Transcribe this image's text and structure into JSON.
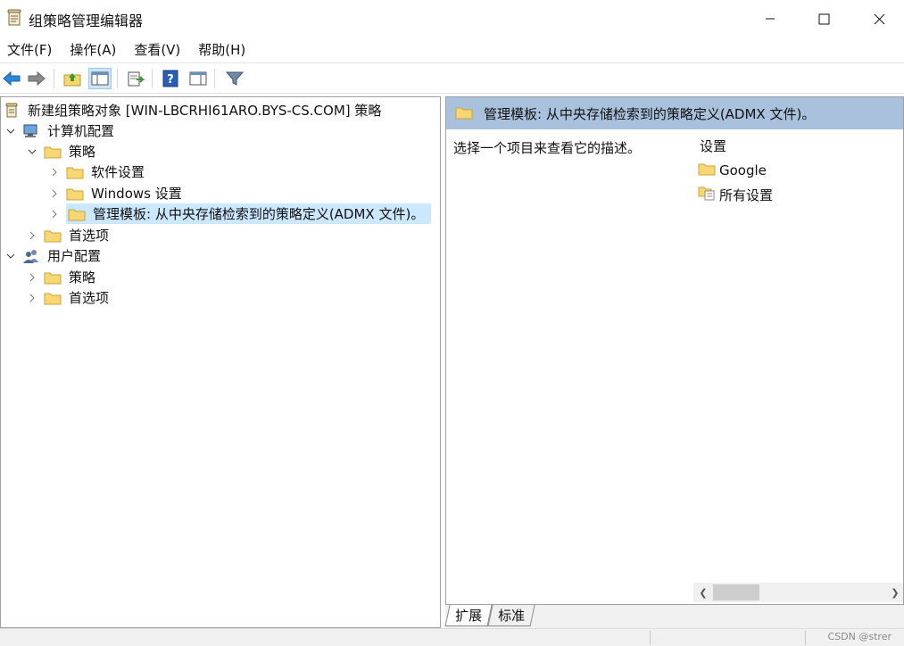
{
  "window": {
    "title": "组策略管理编辑器",
    "icon": "policy-scroll-icon"
  },
  "menu": [
    "文件(F)",
    "操作(A)",
    "查看(V)",
    "帮助(H)"
  ],
  "toolbar": {
    "icons": [
      "back-arrow-icon",
      "forward-arrow-icon",
      "up-folder-icon",
      "show-hide-tree-icon",
      "export-list-icon",
      "help-icon",
      "properties-icon",
      "filter-icon"
    ],
    "accent": "#cce4f7"
  },
  "tree": {
    "root": "新建组策略对象 [WIN-LBCRHI61ARO.BYS-CS.COM] 策略",
    "computer_config": "计算机配置",
    "computer_policy": "策略",
    "software_settings": "软件设置",
    "windows_settings": "Windows 设置",
    "admin_templates": "管理模板: 从中央存储检索到的策略定义(ADMX 文件)。",
    "computer_preferences": "首选项",
    "user_config": "用户配置",
    "user_policy": "策略",
    "user_preferences": "首选项"
  },
  "right": {
    "header": "管理模板: 从中央存储检索到的策略定义(ADMX 文件)。",
    "description": "选择一个项目来查看它的描述。",
    "column_header": "设置",
    "items": [
      "Google",
      "所有设置"
    ],
    "header_color": "#a9c1dc"
  },
  "tabs": [
    "扩展",
    "标准"
  ],
  "watermark": "CSDN @strer"
}
